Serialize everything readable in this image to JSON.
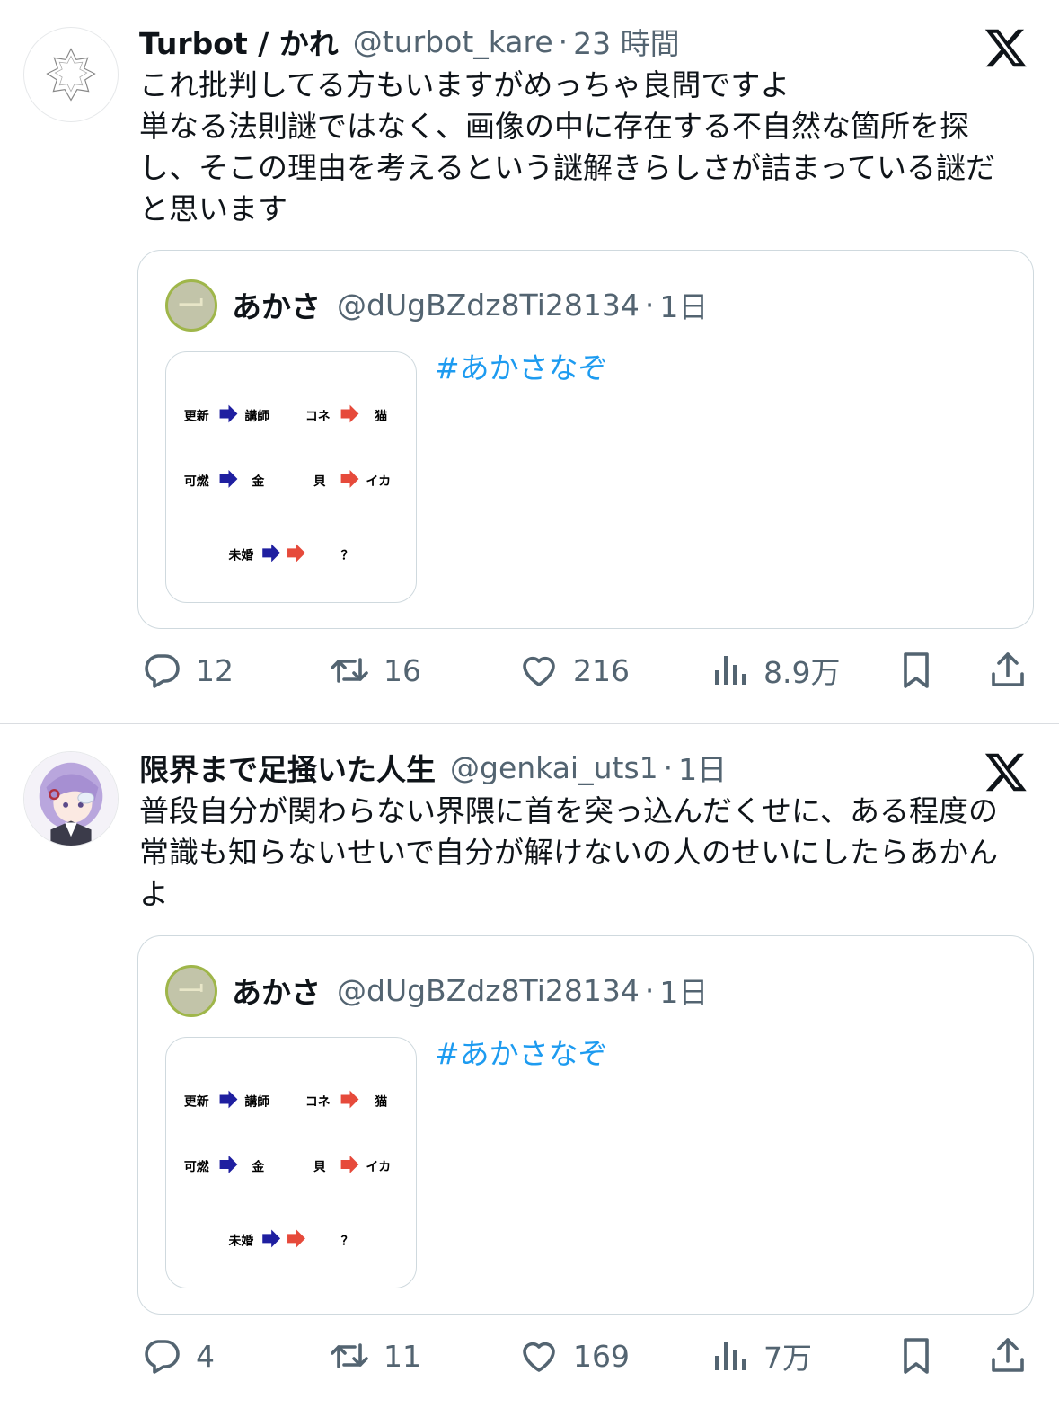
{
  "tweets": [
    {
      "display_name": "Turbot / かれ",
      "handle": "@turbot_kare",
      "separator": "·",
      "time": "23 時間",
      "avatar_icon": "koch-snowflake-avatar",
      "text_lines": [
        "これ批判してる方もいますがめっちゃ良問ですよ",
        "単なる法則謎ではなく、画像の中に存在する不自然な箇所を探",
        "し、そこの理由を考えるという謎解きらしさが詰まっている謎だ",
        "と思います"
      ],
      "quote": {
        "display_name": "あかさ",
        "handle": "@dUgBZdz8Ti28134",
        "separator": "·",
        "time": "1日",
        "hashtag": "#あかさなぞ",
        "puzzle": {
          "row1_left_from": "更新",
          "row1_left_to": "講師",
          "row1_right_from": "コネ",
          "row1_right_to": "猫",
          "row2_left_from": "可燃",
          "row2_left_to": "金",
          "row2_right_from": "貝",
          "row2_right_to": "イカ",
          "row3_from": "未婚",
          "row3_to": "？"
        }
      },
      "actions": {
        "replies": "12",
        "reposts": "16",
        "likes": "216",
        "views": "8.9万"
      }
    },
    {
      "display_name": "限界まで足掻いた人生",
      "handle": "@genkai_uts1",
      "separator": "·",
      "time": "1日",
      "avatar_icon": "anime-girl-avatar",
      "text_lines": [
        "普段自分が関わらない界隈に首を突っ込んだくせに、ある程度の",
        "常識も知らないせいで自分が解けないの人のせいにしたらあかん",
        "よ"
      ],
      "quote": {
        "display_name": "あかさ",
        "handle": "@dUgBZdz8Ti28134",
        "separator": "·",
        "time": "1日",
        "hashtag": "#あかさなぞ",
        "puzzle": {
          "row1_left_from": "更新",
          "row1_left_to": "講師",
          "row1_right_from": "コネ",
          "row1_right_to": "猫",
          "row2_left_from": "可燃",
          "row2_left_to": "金",
          "row2_right_from": "貝",
          "row2_right_to": "イカ",
          "row3_from": "未婚",
          "row3_to": "？"
        }
      },
      "actions": {
        "replies": "4",
        "reposts": "11",
        "likes": "169",
        "views": "7万"
      }
    }
  ],
  "colors": {
    "text": "#0f1419",
    "secondary": "#536471",
    "link": "#1d9bf0",
    "border": "#cfd9de",
    "arrow_blue": "#1f1fa0",
    "arrow_red": "#e64a3b"
  }
}
